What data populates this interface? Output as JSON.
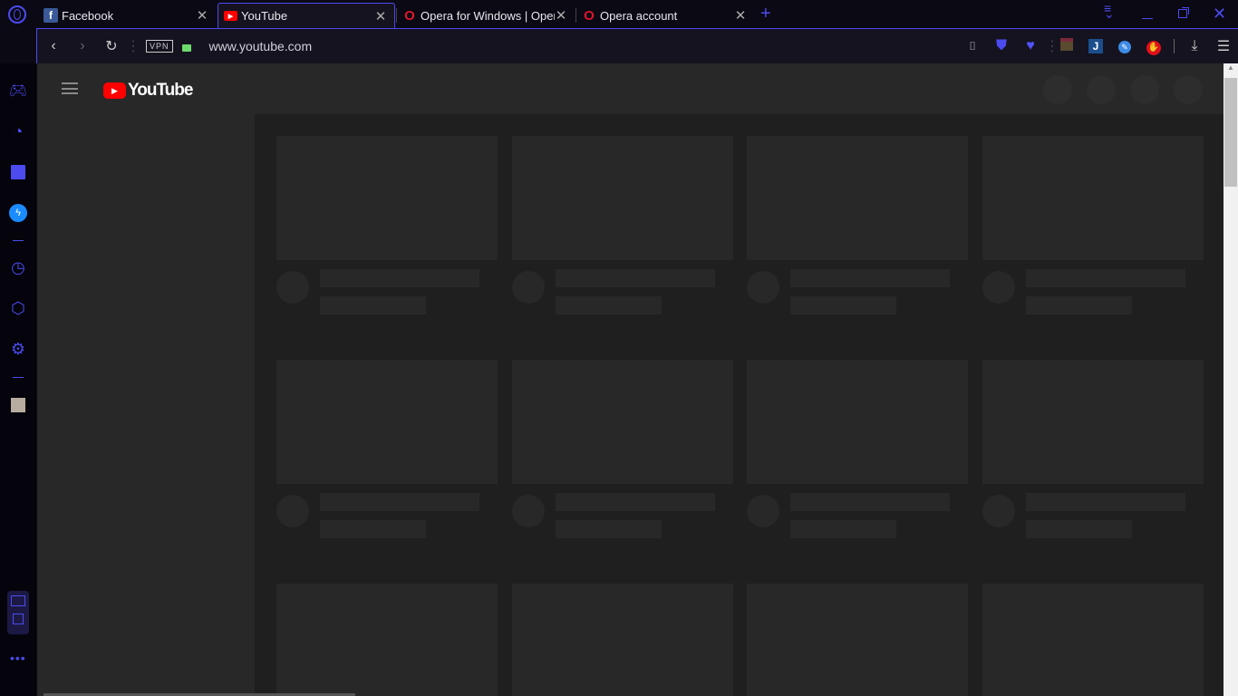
{
  "browser": {
    "accent": "#4b4bf0",
    "tabs": [
      {
        "title": "Facebook",
        "icon": "facebook-icon",
        "active": false
      },
      {
        "title": "YouTube",
        "icon": "youtube-icon",
        "active": true
      },
      {
        "title": "Opera for Windows | Opera",
        "icon": "opera-icon",
        "active": false
      },
      {
        "title": "Opera account",
        "icon": "opera-icon",
        "active": false
      }
    ],
    "new_tab": "+",
    "vpn_label": "VPN",
    "url": "www.youtube.com"
  },
  "youtube": {
    "logo_text": "YouTube",
    "skeleton_rows": 3,
    "skeleton_cols": 4
  }
}
